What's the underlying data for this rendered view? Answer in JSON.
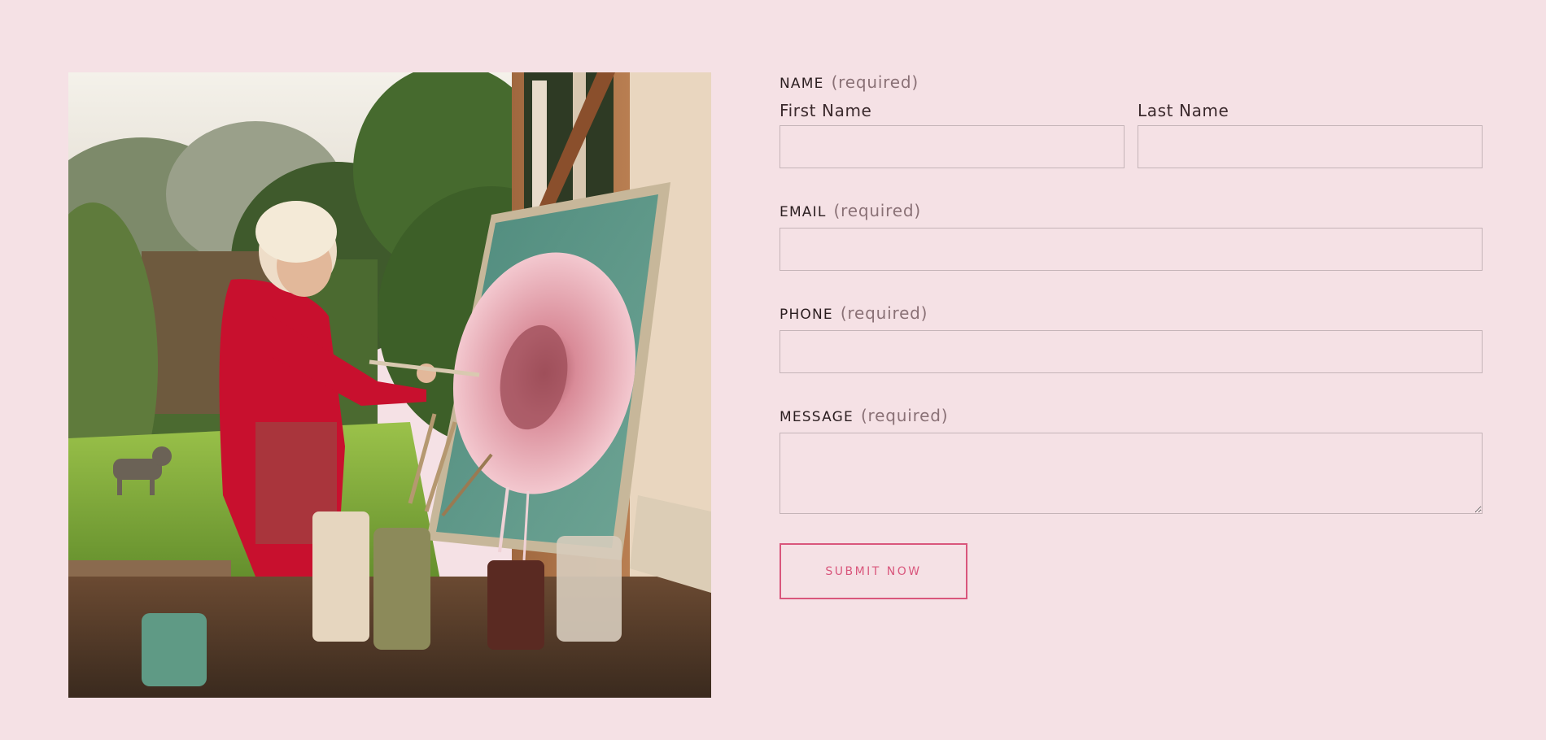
{
  "photo": {
    "alt": "Woman in red overalls painting a pink peony on a canvas in a garden studio"
  },
  "form": {
    "name": {
      "label": "NAME",
      "required": "(required)",
      "first_label": "First Name",
      "last_label": "Last Name",
      "first_value": "",
      "last_value": ""
    },
    "email": {
      "label": "EMAIL",
      "required": "(required)",
      "value": ""
    },
    "phone": {
      "label": "PHONE",
      "required": "(required)",
      "value": ""
    },
    "message": {
      "label": "MESSAGE",
      "required": "(required)",
      "value": ""
    },
    "submit_label": "SUBMIT NOW"
  },
  "colors": {
    "background": "#f5e1e5",
    "accent": "#d9567c",
    "input_border": "#c5b4b8"
  }
}
